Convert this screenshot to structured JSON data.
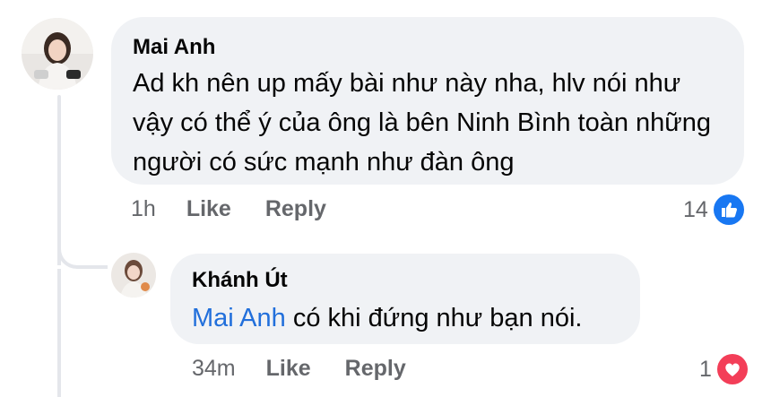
{
  "comment": {
    "author": "Mai Anh",
    "text": "Ad kh nên up mấy bài như này nha, hlv nói như vậy có thể ý của ông là bên Ninh Bình toàn những người có sức mạnh như đàn ông",
    "time": "1h",
    "like_label": "Like",
    "reply_label": "Reply",
    "reaction_count": "14",
    "reaction_icon": "like-icon",
    "reaction_color": "#1877f2"
  },
  "reply": {
    "author": "Khánh Út",
    "mention": "Mai Anh",
    "text": " có khi đứng như bạn nói.",
    "time": "34m",
    "like_label": "Like",
    "reply_label": "Reply",
    "reaction_count": "1",
    "reaction_icon": "love-icon",
    "reaction_color": "#f33e58"
  }
}
